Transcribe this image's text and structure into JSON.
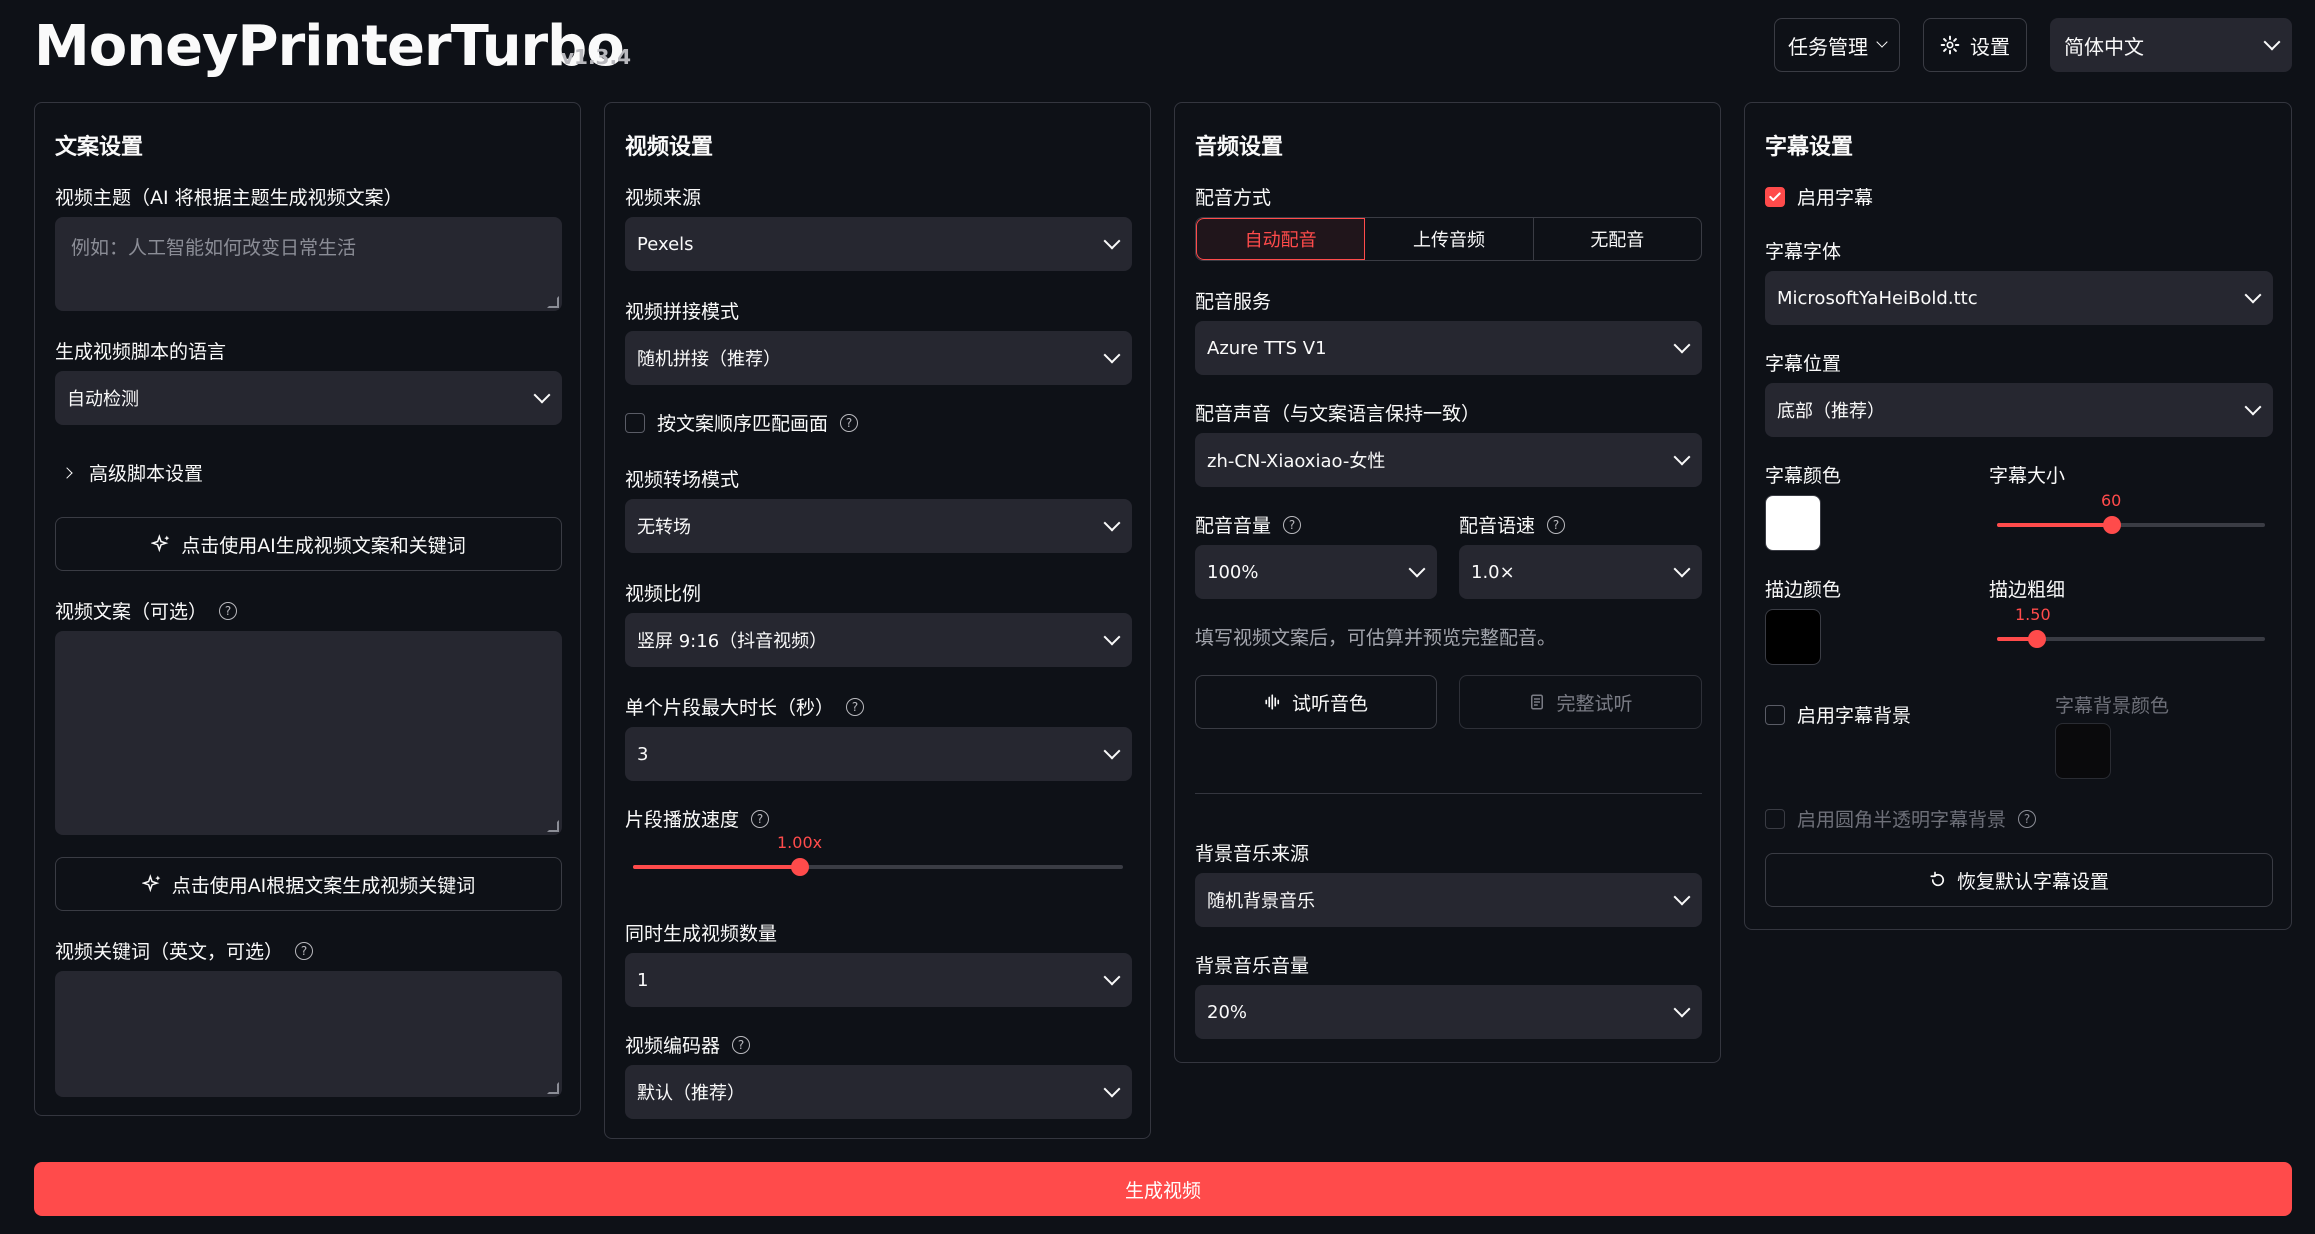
{
  "header": {
    "title": "MoneyPrinterTurbo",
    "version": "v1.3.4",
    "task_btn": "任务管理",
    "settings_btn": "设置",
    "language": "简体中文"
  },
  "script_panel": {
    "title": "文案设置",
    "subject_label": "视频主题（AI 将根据主题生成视频文案）",
    "subject_placeholder": "例如：人工智能如何改变日常生活",
    "lang_label": "生成视频脚本的语言",
    "lang_value": "自动检测",
    "advanced": "高级脚本设置",
    "gen_script_btn": "点击使用AI生成视频文案和关键词",
    "script_label": "视频文案（可选）",
    "gen_terms_btn": "点击使用AI根据文案生成视频关键词",
    "terms_label": "视频关键词（英文，可选）"
  },
  "video_panel": {
    "title": "视频设置",
    "source_label": "视频来源",
    "source_value": "Pexels",
    "concat_label": "视频拼接模式",
    "concat_value": "随机拼接（推荐）",
    "match_label": "按文案顺序匹配画面",
    "transition_label": "视频转场模式",
    "transition_value": "无转场",
    "aspect_label": "视频比例",
    "aspect_value": "竖屏 9:16（抖音视频）",
    "clip_label": "单个片段最大时长（秒）",
    "clip_value": "3",
    "speed_label": "片段播放速度",
    "speed_value": "1.00x",
    "speed_fraction": 0.34,
    "count_label": "同时生成视频数量",
    "count_value": "1",
    "codec_label": "视频编码器",
    "codec_value": "默认（推荐）"
  },
  "audio_panel": {
    "title": "音频设置",
    "mode_label": "配音方式",
    "mode_options": [
      "自动配音",
      "上传音频",
      "无配音"
    ],
    "service_label": "配音服务",
    "service_value": "Azure TTS V1",
    "voice_label": "配音声音（与文案语言保持一致）",
    "voice_value": "zh-CN-Xiaoxiao-女性",
    "volume_label": "配音音量",
    "volume_value": "100%",
    "rate_label": "配音语速",
    "rate_value": "1.0×",
    "note": "填写视频文案后，可估算并预览完整配音。",
    "preview_btn": "试听音色",
    "full_btn": "完整试听",
    "bgm_label": "背景音乐来源",
    "bgm_value": "随机背景音乐",
    "bgm_volume_label": "背景音乐音量",
    "bgm_volume_value": "20%"
  },
  "subtitle_panel": {
    "title": "字幕设置",
    "enable_label": "启用字幕",
    "font_label": "字幕字体",
    "font_value": "MicrosoftYaHeiBold.ttc",
    "position_label": "字幕位置",
    "position_value": "底部（推荐）",
    "color_label": "字幕颜色",
    "color_value": "#ffffff",
    "size_label": "字幕大小",
    "size_value": "60",
    "size_fraction": 0.43,
    "stroke_color_label": "描边颜色",
    "stroke_color_value": "#000000",
    "stroke_width_label": "描边粗细",
    "stroke_width_value": "1.50",
    "stroke_fraction": 0.15,
    "bg_enable_label": "启用字幕背景",
    "bg_color_label": "字幕背景颜色",
    "bg_color_value": "#0a0a0c",
    "rounded_label": "启用圆角半透明字幕背景",
    "reset_btn": "恢复默认字幕设置"
  },
  "generate_btn": "生成视频",
  "colors": {
    "accent": "#ff4b4b",
    "panel_bg": "#0e1117",
    "input_bg": "#262730"
  }
}
